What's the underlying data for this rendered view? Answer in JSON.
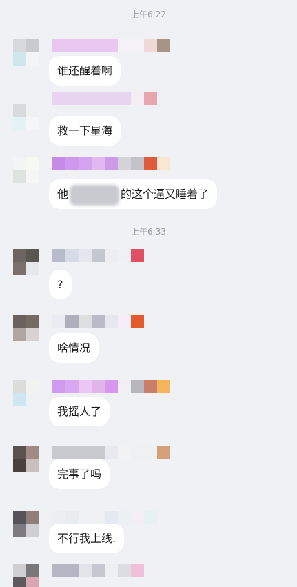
{
  "timestamps": [
    "上午6:22",
    "上午6:33"
  ],
  "messages": [
    {
      "text": "谁还醒着啊"
    },
    {
      "text": "救一下星海"
    },
    {
      "text_before": "他",
      "text_after": "的这个逼又睡着了"
    },
    {
      "text": "?"
    },
    {
      "text": "啥情况"
    },
    {
      "text": "我摇人了"
    },
    {
      "text": "完事了吗"
    },
    {
      "text": "不行我上线."
    }
  ],
  "colors": {
    "background": "#f0f1f5",
    "bubble": "#ffffff",
    "timestamp": "#9a9ba3"
  }
}
